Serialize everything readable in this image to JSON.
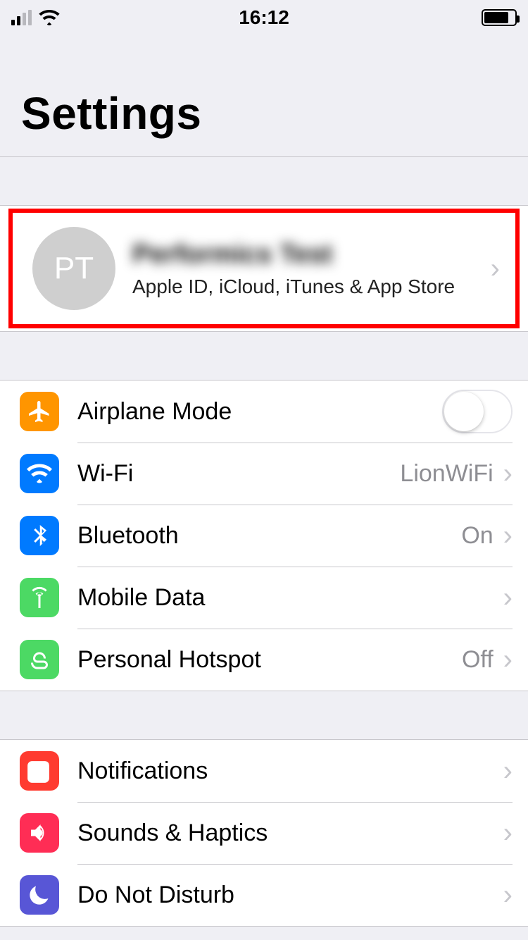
{
  "status": {
    "time": "16:12"
  },
  "page": {
    "title": "Settings"
  },
  "apple_id": {
    "avatar_initials": "PT",
    "name": "Performics Test",
    "subtitle": "Apple ID, iCloud, iTunes & App Store"
  },
  "groups": {
    "connectivity": {
      "airplane_mode": {
        "label": "Airplane Mode",
        "toggle": false
      },
      "wifi": {
        "label": "Wi-Fi",
        "value": "LionWiFi"
      },
      "bluetooth": {
        "label": "Bluetooth",
        "value": "On"
      },
      "mobile_data": {
        "label": "Mobile Data",
        "value": ""
      },
      "personal_hotspot": {
        "label": "Personal Hotspot",
        "value": "Off"
      }
    },
    "alerts": {
      "notifications": {
        "label": "Notifications"
      },
      "sounds": {
        "label": "Sounds & Haptics"
      },
      "dnd": {
        "label": "Do Not Disturb"
      }
    }
  }
}
